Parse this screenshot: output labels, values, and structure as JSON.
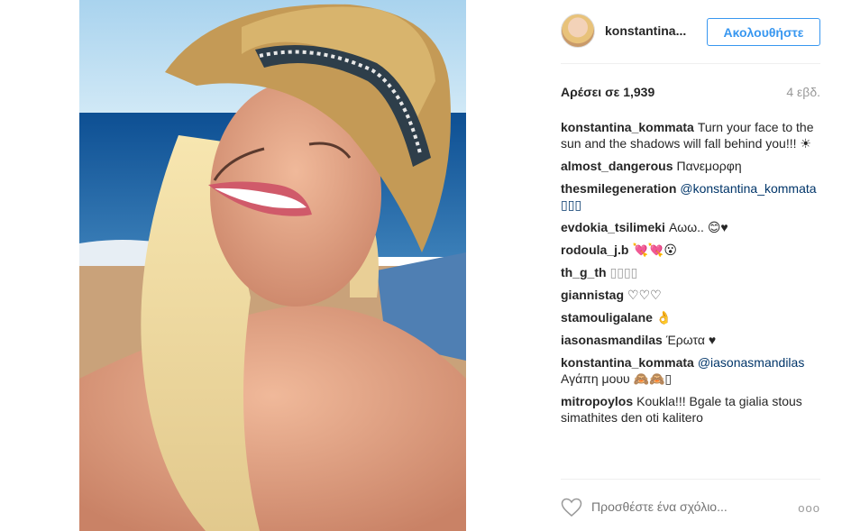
{
  "post": {
    "username": "konstantina...",
    "follow_label": "Ακολουθήστε",
    "likes_text": "Αρέσει σε 1,939",
    "age": "4 εβδ."
  },
  "comments": [
    {
      "user": "konstantina_kommata",
      "text": "Turn your face to the sun and the shadows will fall behind you!!! ☀"
    },
    {
      "user": "almost_dangerous",
      "text": "Πανεμορφη"
    },
    {
      "user": "thesmilegeneration",
      "mention": "@konstantina_kommata",
      "text": "▯▯▯"
    },
    {
      "user": "evdokia_tsilimeki",
      "text": "Αωω.. 😊♥"
    },
    {
      "user": "rodoula_j.b",
      "text": "💘💘😮"
    },
    {
      "user": "th_g_th",
      "text": "▯▯▯▯"
    },
    {
      "user": "giannistag",
      "text": "♡♡♡"
    },
    {
      "user": "stamouligalane",
      "text": "👌"
    },
    {
      "user": "iasonasmandilas",
      "text": "Έρωτα ♥"
    },
    {
      "user": "konstantina_kommata",
      "mention": "@iasonasmandilas",
      "text": "Αγάπη μουυ 🙈🙈▯"
    },
    {
      "user": "mitropoylos",
      "text": "Koukla!!! Bgale ta gialia stous simathites den oti kalitero"
    }
  ],
  "footer": {
    "comment_placeholder": "Προσθέστε ένα σχόλιο...",
    "more_label": "ooo"
  },
  "icons": {
    "like": "heart-icon",
    "options": "more-options-icon"
  },
  "colors": {
    "accent": "#3897f0",
    "mention": "#003569",
    "muted": "#999999",
    "text": "#262626"
  }
}
